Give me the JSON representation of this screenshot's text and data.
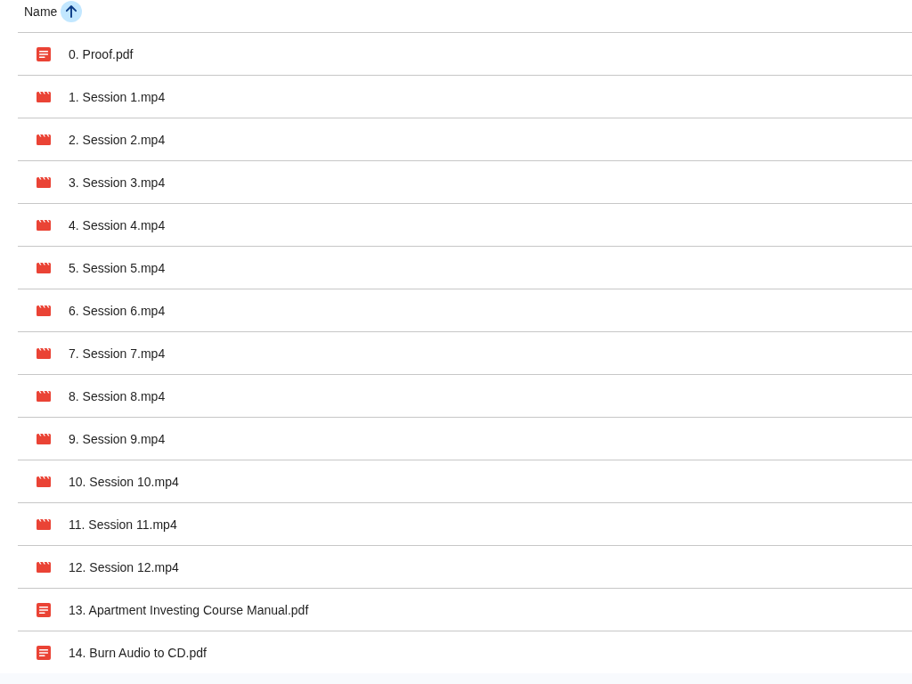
{
  "table": {
    "columns": [
      {
        "label": "Name",
        "sort_ascending": true
      }
    ],
    "rows": [
      {
        "kind": "pdf",
        "name": "0. Proof.pdf"
      },
      {
        "kind": "video",
        "name": "1. Session 1.mp4"
      },
      {
        "kind": "video",
        "name": "2. Session 2.mp4"
      },
      {
        "kind": "video",
        "name": "3. Session 3.mp4"
      },
      {
        "kind": "video",
        "name": "4. Session 4.mp4"
      },
      {
        "kind": "video",
        "name": "5. Session 5.mp4"
      },
      {
        "kind": "video",
        "name": "6. Session 6.mp4"
      },
      {
        "kind": "video",
        "name": "7. Session 7.mp4"
      },
      {
        "kind": "video",
        "name": "8. Session 8.mp4"
      },
      {
        "kind": "video",
        "name": "9. Session 9.mp4"
      },
      {
        "kind": "video",
        "name": "10. Session 10.mp4"
      },
      {
        "kind": "video",
        "name": "11. Session 11.mp4"
      },
      {
        "kind": "video",
        "name": "12. Session 12.mp4"
      },
      {
        "kind": "pdf",
        "name": "13. Apartment Investing Course Manual.pdf"
      },
      {
        "kind": "pdf",
        "name": "14. Burn Audio to CD.pdf"
      }
    ]
  }
}
